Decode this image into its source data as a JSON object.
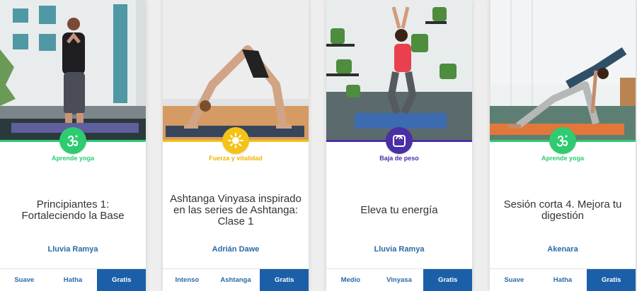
{
  "colors": {
    "green": "#2ecb71",
    "yellow": "#f5c318",
    "purple": "#4a2fa6",
    "link_blue": "#2a6aa6",
    "gratis_bg": "#1a5fa8"
  },
  "cards": [
    {
      "category": "Aprende yoga",
      "category_color": "green",
      "icon": "om-icon",
      "title": "Principiantes 1: Fortaleciendo la Base",
      "instructor": "Lluvia Ramya",
      "tags": [
        "Suave",
        "Hatha",
        "Gratis"
      ]
    },
    {
      "category": "Fuerza y vitalidad",
      "category_color": "yellow",
      "icon": "sun-icon",
      "title": "Ashtanga Vinyasa inspirado en las series de Ashtanga: Clase 1",
      "instructor": "Adrián Dawe",
      "tags": [
        "Intenso",
        "Ashtanga",
        "Gratis"
      ]
    },
    {
      "category": "Baja de peso",
      "category_color": "purple",
      "icon": "scale-icon",
      "title": "Eleva tu energía",
      "instructor": "Lluvia Ramya",
      "tags": [
        "Medio",
        "Vinyasa",
        "Gratis"
      ]
    },
    {
      "category": "Aprende yoga",
      "category_color": "green",
      "icon": "om-icon",
      "title": "Sesión corta 4. Mejora tu digestión",
      "instructor": "Akenara",
      "tags": [
        "Suave",
        "Hatha",
        "Gratis"
      ]
    }
  ]
}
